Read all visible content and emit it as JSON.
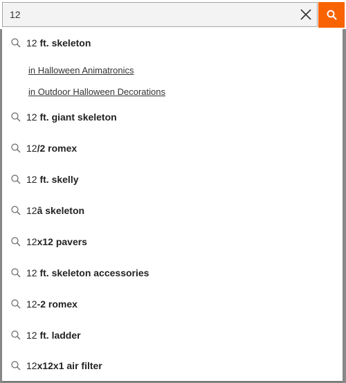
{
  "search": {
    "value": "12",
    "placeholder": "",
    "clear_icon": "close-icon",
    "submit_icon": "search-icon",
    "accent_color": "#f96302"
  },
  "suggestions": [
    {
      "prefix": "12",
      "rest": " ft. skeleton",
      "sub": [
        "in Halloween Animatronics",
        "in Outdoor Halloween Decorations"
      ]
    },
    {
      "prefix": "12",
      "rest": " ft. giant skeleton"
    },
    {
      "prefix": "12",
      "rest": "/2 romex"
    },
    {
      "prefix": "12",
      "rest": " ft. skelly"
    },
    {
      "prefix": "12",
      "rest": "â skeleton"
    },
    {
      "prefix": "12",
      "rest": "x12 pavers"
    },
    {
      "prefix": "12",
      "rest": " ft. skeleton accessories"
    },
    {
      "prefix": "12",
      "rest": "-2 romex"
    },
    {
      "prefix": "12",
      "rest": " ft. ladder"
    },
    {
      "prefix": "12",
      "rest": "x12x1 air filter"
    }
  ]
}
